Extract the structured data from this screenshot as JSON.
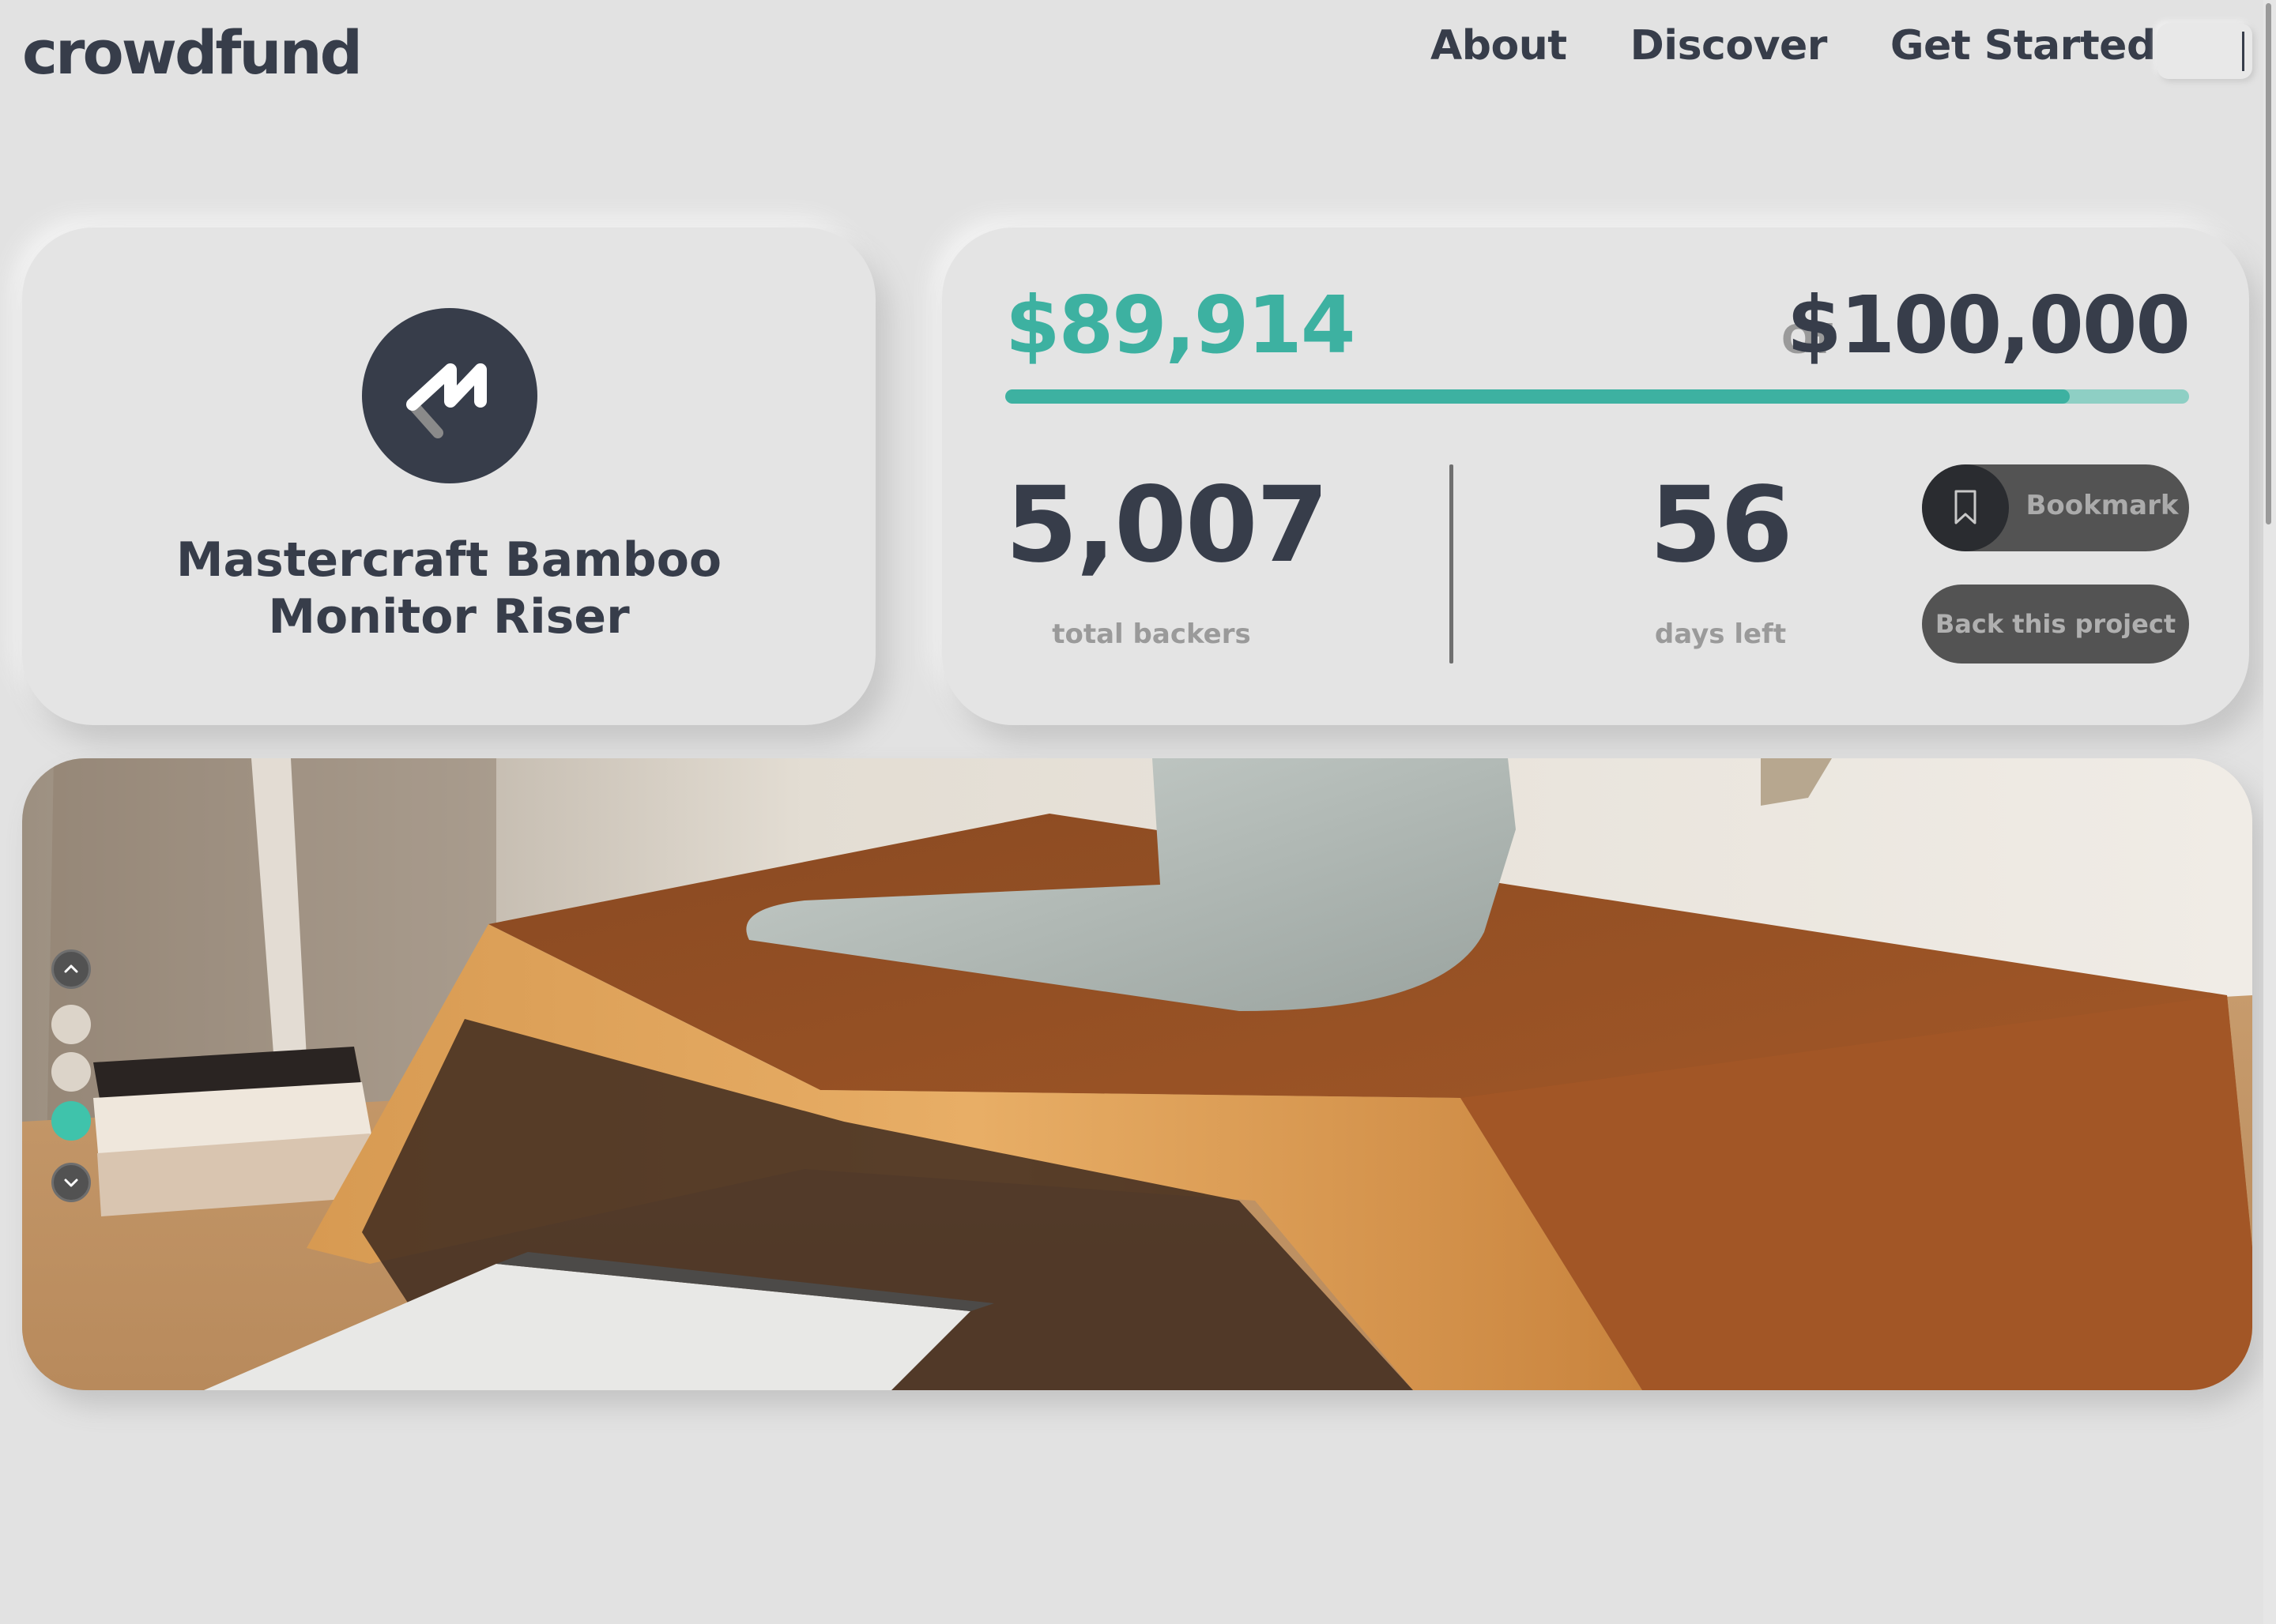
{
  "brand": {
    "name": "crowdfund"
  },
  "nav": {
    "items": [
      {
        "label": "About"
      },
      {
        "label": "Discover"
      },
      {
        "label": "Get Started"
      }
    ]
  },
  "project": {
    "title_line1": "Mastercraft Bamboo",
    "title_line2": "Monitor Riser",
    "logo_icon": "mastercraft-logo-icon"
  },
  "funding": {
    "raised": "$89,914",
    "of_label": "Of",
    "goal": "$100,000",
    "progress_fraction": 0.89914,
    "backers": "5,007",
    "backers_label": "total backers",
    "days_left": "56",
    "days_label": "days left"
  },
  "actions": {
    "bookmark_label": "Bookmark",
    "back_label": "Back this project"
  },
  "gallery": {
    "active_index": 2,
    "slide_count": 3,
    "up_icon": "chevron-up-icon",
    "down_icon": "chevron-down-icon"
  },
  "colors": {
    "accent": "#3db1a1",
    "dark": "#373d4a",
    "background": "#e2e2e2",
    "button": "#535353"
  }
}
